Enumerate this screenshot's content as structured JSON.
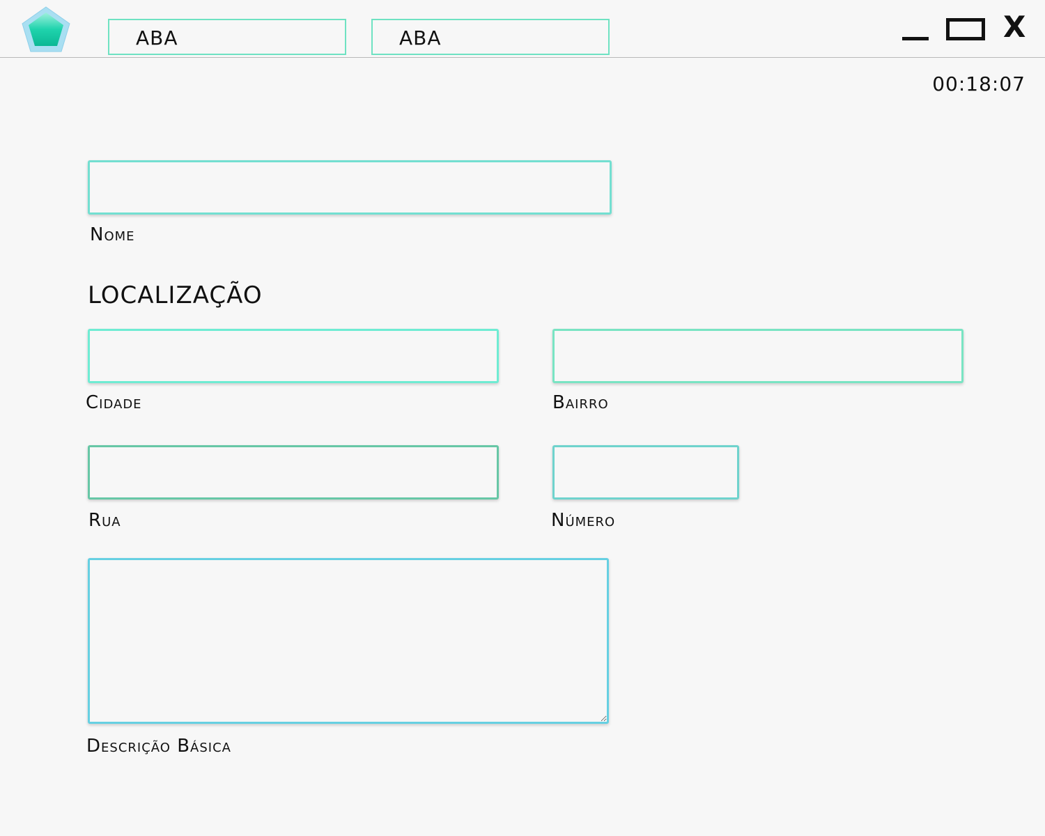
{
  "header": {
    "logo_icon": "pentagon-gem-icon",
    "tabs": [
      {
        "label": "ABA"
      },
      {
        "label": "ABA"
      }
    ],
    "window_controls": {
      "minimize_icon": "minimize-icon",
      "maximize_icon": "maximize-icon",
      "close_label": "X"
    }
  },
  "timer": "00:18:07",
  "form": {
    "nome_label": "Nome",
    "section_title": "LOCALIZAÇÃO",
    "cidade_label": "Cidade",
    "bairro_label": "Bairro",
    "rua_label": "Rua",
    "numero_label": "Número",
    "descricao_label": "Descrição Básica"
  },
  "colors": {
    "background": "#f7f7f7",
    "accent": "#6fe2c2",
    "logo_fill": "#12c9a6",
    "logo_border": "#a8dff0"
  }
}
